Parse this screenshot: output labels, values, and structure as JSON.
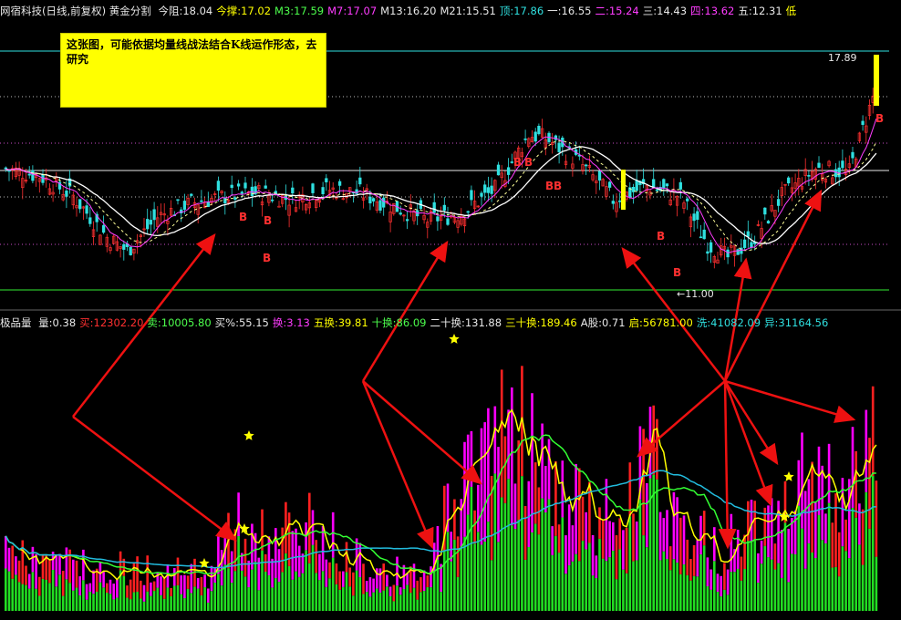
{
  "top_header": {
    "title": "网宿科技(日线,前复权) 黄金分割",
    "items": [
      {
        "label": "今阻:",
        "value": "18.04",
        "color": "#e8e8e8"
      },
      {
        "label": "今撑:",
        "value": "17.02",
        "color": "#ffff00"
      },
      {
        "label": "M3:",
        "value": "17.59",
        "color": "#4dff4d"
      },
      {
        "label": "M7:",
        "value": "17.07",
        "color": "#ff3cff"
      },
      {
        "label": "M13:",
        "value": "16.20",
        "color": "#e8e8e8"
      },
      {
        "label": "M21:",
        "value": "15.51",
        "color": "#e8e8e8"
      },
      {
        "label": "顶:",
        "value": "17.86",
        "color": "#2fe0e0"
      },
      {
        "label": "一:",
        "value": "16.55",
        "color": "#e8e8e8"
      },
      {
        "label": "二:",
        "value": "15.24",
        "color": "#ff3cff"
      },
      {
        "label": "三:",
        "value": "14.43",
        "color": "#e8e8e8"
      },
      {
        "label": "四:",
        "value": "13.62",
        "color": "#ff3cff"
      },
      {
        "label": "五:",
        "value": "12.31",
        "color": "#e8e8e8"
      },
      {
        "label": "低",
        "value": "",
        "color": "#ffff00"
      }
    ]
  },
  "mid_header": {
    "title": "极品量",
    "items": [
      {
        "label": "量:",
        "value": "0.38",
        "color": "#e8e8e8"
      },
      {
        "label": "买:",
        "value": "12302.20",
        "color": "#ff3030"
      },
      {
        "label": "卖:",
        "value": "10005.80",
        "color": "#4dff4d"
      },
      {
        "label": "买%:",
        "value": "55.15",
        "color": "#e8e8e8"
      },
      {
        "label": "换:",
        "value": "3.13",
        "color": "#ff3cff"
      },
      {
        "label": "五换:",
        "value": "39.81",
        "color": "#ffff00"
      },
      {
        "label": "十换:",
        "value": "86.09",
        "color": "#4dff4d"
      },
      {
        "label": "二十换:",
        "value": "131.88",
        "color": "#e8e8e8"
      },
      {
        "label": "三十换:",
        "value": "189.46",
        "color": "#ffff00"
      },
      {
        "label": "A股:",
        "value": "0.71",
        "color": "#e8e8e8"
      },
      {
        "label": "启:",
        "value": "56781.00",
        "color": "#ffff00"
      },
      {
        "label": "洗:",
        "value": "41082.09",
        "color": "#2fe0e0"
      },
      {
        "label": "异:",
        "value": "31164.56",
        "color": "#2fe0e0"
      }
    ]
  },
  "annotation": {
    "text": "这张图，可能依据均量线战法结合K线运作形态，去研究"
  },
  "price_labels": {
    "high": "17.89",
    "low": "11.00"
  },
  "signal_labels": [
    "B",
    "B",
    "B",
    "B",
    "B",
    "B",
    "B",
    "B",
    "B",
    "B"
  ],
  "colors": {
    "background": "#000000",
    "up_candle": "#ff3030",
    "down_candle": "#2fe0e0",
    "ma_white": "#ffffff",
    "ma_magenta": "#ff3cff",
    "ma_dashed": "#ffff99",
    "vol_green": "#22dd22",
    "vol_magenta": "#ff00ff",
    "vol_red": "#ff2020",
    "vol_yellow_line": "#ffff00",
    "vol_green_line": "#33ff33",
    "vol_cyan_line": "#22bbdd",
    "arrows": "#ee1111"
  },
  "chart_data": {
    "type": "candlestick-volume",
    "price_range": [
      11.0,
      17.89
    ],
    "golden_levels": [
      {
        "name": "顶",
        "value": 17.86
      },
      {
        "name": "一",
        "value": 16.55
      },
      {
        "name": "二",
        "value": 15.24
      },
      {
        "name": "三",
        "value": 14.43
      },
      {
        "name": "四",
        "value": 13.62
      },
      {
        "name": "五",
        "value": 12.31
      }
    ],
    "close_keypoints": [
      [
        0,
        14.6
      ],
      [
        10,
        14.4
      ],
      [
        20,
        13.8
      ],
      [
        30,
        12.6
      ],
      [
        36,
        12.2
      ],
      [
        45,
        13.2
      ],
      [
        55,
        13.6
      ],
      [
        65,
        13.8
      ],
      [
        75,
        13.9
      ],
      [
        85,
        13.7
      ],
      [
        95,
        14.0
      ],
      [
        105,
        13.9
      ],
      [
        115,
        13.5
      ],
      [
        125,
        13.1
      ],
      [
        135,
        13.3
      ],
      [
        145,
        14.0
      ],
      [
        155,
        15.6
      ],
      [
        160,
        15.5
      ],
      [
        170,
        14.8
      ],
      [
        180,
        13.7
      ],
      [
        190,
        14.1
      ],
      [
        200,
        13.8
      ],
      [
        208,
        12.4
      ],
      [
        214,
        12.0
      ],
      [
        222,
        12.6
      ],
      [
        230,
        13.8
      ],
      [
        240,
        14.6
      ],
      [
        250,
        14.5
      ],
      [
        258,
        17.0
      ]
    ],
    "volume_ratio_keypoints": [
      [
        0,
        0.18
      ],
      [
        30,
        0.15
      ],
      [
        60,
        0.12
      ],
      [
        66,
        0.3
      ],
      [
        74,
        0.25
      ],
      [
        90,
        0.28
      ],
      [
        110,
        0.15
      ],
      [
        125,
        0.1
      ],
      [
        130,
        0.32
      ],
      [
        140,
        0.55
      ],
      [
        150,
        0.7
      ],
      [
        160,
        0.45
      ],
      [
        175,
        0.3
      ],
      [
        185,
        0.45
      ],
      [
        190,
        0.55
      ],
      [
        200,
        0.3
      ],
      [
        212,
        0.2
      ],
      [
        225,
        0.35
      ],
      [
        232,
        0.45
      ],
      [
        245,
        0.4
      ],
      [
        252,
        0.6
      ],
      [
        258,
        0.55
      ]
    ]
  }
}
